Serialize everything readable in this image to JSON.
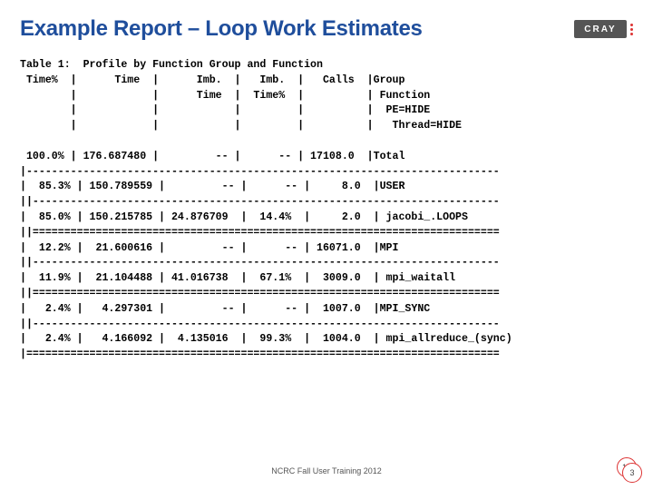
{
  "logo_text": "CRAY",
  "title": "Example Report – Loop Work Estimates",
  "footer": "NCRC Fall User Training 2012",
  "page_a": "14",
  "page_b": "3",
  "report_lines": [
    "Table 1:  Profile by Function Group and Function",
    " Time%  |      Time  |      Imb.  |   Imb.  |   Calls  |Group",
    "        |            |      Time  |  Time%  |          | Function",
    "        |            |            |         |          |  PE=HIDE",
    "        |            |            |         |          |   Thread=HIDE",
    "",
    " 100.0% | 176.687480 |         -- |      -- | 17108.0  |Total",
    "|---------------------------------------------------------------------------",
    "|  85.3% | 150.789559 |         -- |      -- |     8.0  |USER",
    "||--------------------------------------------------------------------------",
    "|  85.0% | 150.215785 | 24.876709  |  14.4%  |     2.0  | jacobi_.LOOPS",
    "||==========================================================================",
    "|  12.2% |  21.600616 |         -- |      -- | 16071.0  |MPI",
    "||--------------------------------------------------------------------------",
    "|  11.9% |  21.104488 | 41.016738  |  67.1%  |  3009.0  | mpi_waitall",
    "||==========================================================================",
    "|   2.4% |   4.297301 |         -- |      -- |  1007.0  |MPI_SYNC",
    "||--------------------------------------------------------------------------",
    "|   2.4% |   4.166092 |  4.135016  |  99.3%  |  1004.0  | mpi_allreduce_(sync)",
    "|==========================================================================="
  ]
}
